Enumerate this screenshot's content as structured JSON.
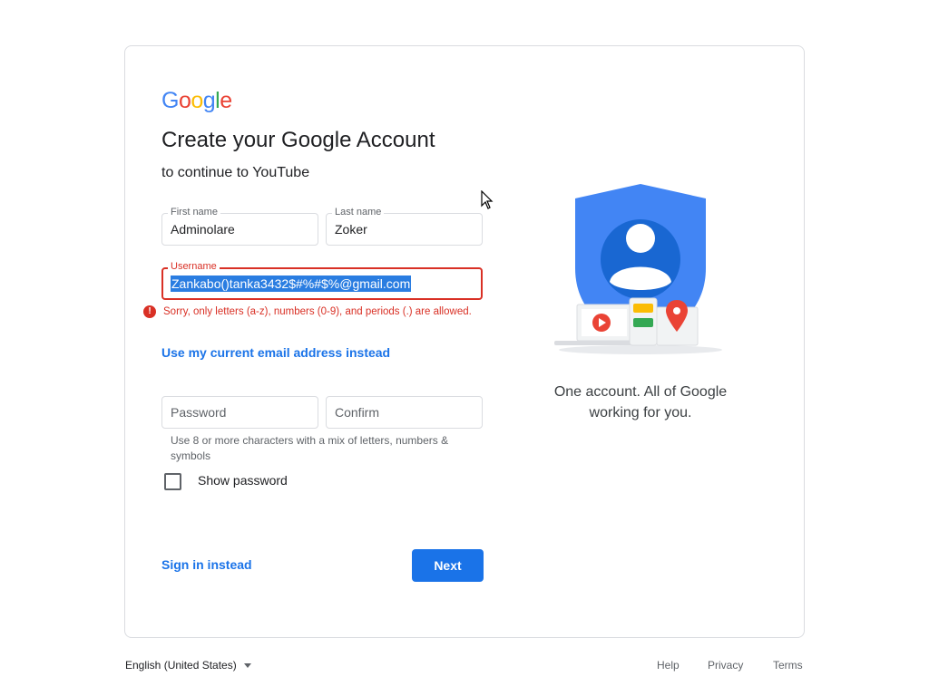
{
  "logo": {
    "letters": [
      "G",
      "o",
      "o",
      "g",
      "l",
      "e"
    ],
    "colors": [
      "#4285f4",
      "#ea4335",
      "#fbbc05",
      "#4285f4",
      "#34a853",
      "#ea4335"
    ]
  },
  "header": {
    "title": "Create your Google Account",
    "subtitle": "to continue to YouTube"
  },
  "form": {
    "first_name": {
      "label": "First name",
      "value": "Adminolare"
    },
    "last_name": {
      "label": "Last name",
      "value": "Zoker"
    },
    "username": {
      "label": "Username",
      "value": "Zankabo()tanka3432$#%#$%@gmail.com",
      "error": "Sorry, only letters (a-z), numbers (0-9), and periods (.) are allowed."
    },
    "use_email_link": "Use my current email address instead",
    "password": {
      "placeholder": "Password"
    },
    "confirm": {
      "placeholder": "Confirm"
    },
    "password_hint": "Use 8 or more characters with a mix of letters, numbers & symbols",
    "show_password": "Show password",
    "sign_in_link": "Sign in instead",
    "next_button": "Next"
  },
  "illustration": {
    "icon": "account-shield-icon",
    "caption_line1": "One account. All of Google",
    "caption_line2": "working for you."
  },
  "footer": {
    "language": "English (United States)",
    "help": "Help",
    "privacy": "Privacy",
    "terms": "Terms"
  },
  "colors": {
    "accent": "#1a73e8",
    "error": "#d93025",
    "selection": "#2a7de1"
  }
}
